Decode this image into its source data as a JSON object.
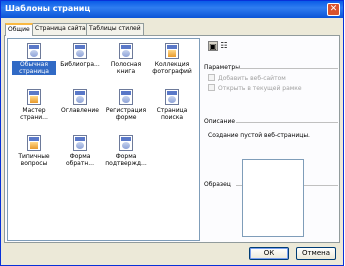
{
  "window": {
    "title": "Шаблоны страниц"
  },
  "tabs": [
    {
      "label": "Общие",
      "active": true
    },
    {
      "label": "Страница сайта",
      "active": false
    },
    {
      "label": "Таблицы стилей",
      "active": false
    }
  ],
  "templates": [
    {
      "label": "Обычная страница",
      "selected": true,
      "icon": "blank-page-icon"
    },
    {
      "label": "Библиогра...",
      "selected": false,
      "icon": "bibliography-page-icon"
    },
    {
      "label": "Полосная книга",
      "selected": false,
      "icon": "guestbook-page-icon"
    },
    {
      "label": "Коллекция фотографий",
      "selected": false,
      "icon": "photo-gallery-page-icon"
    },
    {
      "label": "Мастер страни...",
      "selected": false,
      "icon": "page-wizard-icon"
    },
    {
      "label": "Оглавление",
      "selected": false,
      "icon": "table-of-contents-page-icon"
    },
    {
      "label": "Регистрация форме",
      "selected": false,
      "icon": "registration-form-page-icon"
    },
    {
      "label": "Страница поиска",
      "selected": false,
      "icon": "search-page-icon"
    },
    {
      "label": "Типичные вопросы",
      "selected": false,
      "icon": "faq-page-icon"
    },
    {
      "label": "Форма обратн...",
      "selected": false,
      "icon": "feedback-form-page-icon"
    },
    {
      "label": "Форма подтвержд...",
      "selected": false,
      "icon": "confirmation-form-page-icon"
    }
  ],
  "options": {
    "heading": "Параметры",
    "checkbox1": "Добавить веб-сайтом",
    "checkbox2": "Открыть в текущей рамке"
  },
  "description": {
    "heading": "Описание",
    "text": "Создание пустой веб-страницы."
  },
  "preview": {
    "heading": "Образец"
  },
  "buttons": {
    "ok": "ОК",
    "cancel": "Отмена"
  }
}
